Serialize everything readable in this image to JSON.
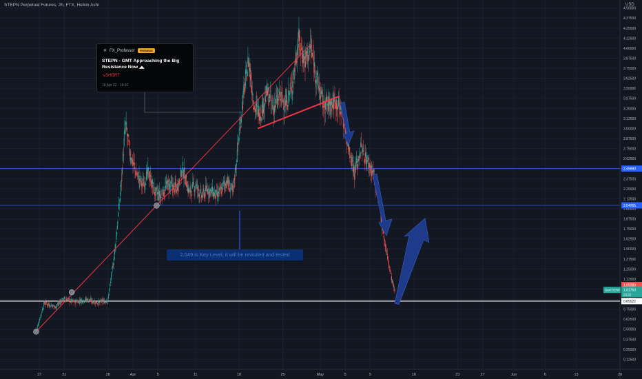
{
  "header": {
    "title": "STEPN Perpetual Futures, 2h, FTX, Heikin Ashi",
    "currency": "USD"
  },
  "idea_card": {
    "author": "FX_Professor",
    "badge": "PREMIUM",
    "headline": "STEPN - GMT Approaching the Big Resistance Now",
    "signal": "SHORT",
    "date": "18 Apr 22 · 19:32"
  },
  "note": {
    "text": "2.049 is Key Level, it will be revisited and tested"
  },
  "colors": {
    "background": "#131722",
    "candle_up": "#26a69a",
    "candle_down": "#ef5350",
    "trendline": "#f23645",
    "level_line": "#2962ff",
    "arrow": "#1e3a8a",
    "white_level": "#ffffff"
  },
  "chart_data": {
    "type": "candlestick",
    "title": "STEPN Perpetual Futures, 2h, FTX, Heikin Ashi",
    "y_axis": {
      "ticks": [
        0.125,
        0.25,
        0.375,
        0.5,
        0.625,
        0.75,
        0.875,
        1.0,
        1.125,
        1.25,
        1.375,
        1.5,
        1.625,
        1.75,
        1.875,
        2.0,
        2.125,
        2.25,
        2.375,
        2.5,
        2.625,
        2.75,
        2.875,
        3.0,
        3.125,
        3.25,
        3.375,
        3.5,
        3.625,
        3.75,
        3.875,
        4.0,
        4.125,
        4.25,
        4.375,
        4.5
      ],
      "tick_labels": [
        "0.12500",
        "0.25000",
        "0.37500",
        "0.50000",
        "0.62500",
        "0.75000",
        "0.87500",
        "1.00000",
        "1.12500",
        "1.25000",
        "1.37500",
        "1.50000",
        "1.62500",
        "1.75000",
        "1.87500",
        "2.00000",
        "2.12500",
        "2.25000",
        "2.37500",
        "2.50000",
        "2.62500",
        "2.75000",
        "2.87500",
        "3.00000",
        "3.12500",
        "3.25000",
        "3.37500",
        "3.50000",
        "3.62500",
        "3.75000",
        "3.87500",
        "4.00000",
        "4.12500",
        "4.25000",
        "4.37500",
        "4.50000"
      ],
      "range": [
        0.0,
        4.6
      ],
      "side": "right"
    },
    "x_axis": {
      "day_range": [
        15.5,
        81
      ],
      "ticks": [
        {
          "day": 17,
          "label": "17"
        },
        {
          "day": 21,
          "label": "21"
        },
        {
          "day": 28,
          "label": "28"
        },
        {
          "day": 32,
          "label": "Apr"
        },
        {
          "day": 36,
          "label": "5"
        },
        {
          "day": 42,
          "label": "11"
        },
        {
          "day": 49,
          "label": "18"
        },
        {
          "day": 56,
          "label": "25"
        },
        {
          "day": 62,
          "label": "May"
        },
        {
          "day": 66,
          "label": "5"
        },
        {
          "day": 70,
          "label": "9"
        },
        {
          "day": 77,
          "label": "16"
        },
        {
          "day": 84,
          "label": "23"
        },
        {
          "day": 88,
          "label": "27"
        },
        {
          "day": 93,
          "label": "Jun"
        },
        {
          "day": 98,
          "label": "6"
        },
        {
          "day": 103,
          "label": "13"
        },
        {
          "day": 110,
          "label": "20"
        }
      ]
    },
    "price_path": [
      [
        16.5,
        0.47
      ],
      [
        17.8,
        0.83
      ],
      [
        19.5,
        0.78
      ],
      [
        21,
        0.88
      ],
      [
        22.5,
        0.84
      ],
      [
        24.5,
        0.87
      ],
      [
        26.5,
        0.83
      ],
      [
        28,
        0.86
      ],
      [
        29,
        1.4
      ],
      [
        30,
        2.2
      ],
      [
        30.8,
        3.05
      ],
      [
        31.5,
        2.7
      ],
      [
        32.5,
        2.45
      ],
      [
        33.5,
        2.3
      ],
      [
        34.5,
        2.45
      ],
      [
        35.5,
        2.2
      ],
      [
        36.5,
        2.15
      ],
      [
        37.5,
        2.3
      ],
      [
        39,
        2.25
      ],
      [
        40,
        2.5
      ],
      [
        41,
        2.2
      ],
      [
        42,
        2.3
      ],
      [
        43,
        2.15
      ],
      [
        44,
        2.25
      ],
      [
        45.5,
        2.15
      ],
      [
        47,
        2.35
      ],
      [
        48,
        2.2
      ],
      [
        48.5,
        2.55
      ],
      [
        49.5,
        3.3
      ],
      [
        50.5,
        3.85
      ],
      [
        51.5,
        3.25
      ],
      [
        52.5,
        3.2
      ],
      [
        53.5,
        3.45
      ],
      [
        54.5,
        3.25
      ],
      [
        55.5,
        3.4
      ],
      [
        56.5,
        3.3
      ],
      [
        57.5,
        3.55
      ],
      [
        58.5,
        4.1
      ],
      [
        59.5,
        3.85
      ],
      [
        60.5,
        4.0
      ],
      [
        61.5,
        3.6
      ],
      [
        62.5,
        3.3
      ],
      [
        63.5,
        3.3
      ],
      [
        64.5,
        3.35
      ],
      [
        65.5,
        3.2
      ],
      [
        66.5,
        2.8
      ],
      [
        67.5,
        2.45
      ],
      [
        68.5,
        2.75
      ],
      [
        69.5,
        2.6
      ],
      [
        70.5,
        2.45
      ],
      [
        71.5,
        2.05
      ],
      [
        72,
        1.75
      ],
      [
        72.5,
        1.5
      ],
      [
        73,
        1.3
      ],
      [
        73.5,
        1.1
      ],
      [
        74,
        0.95
      ]
    ],
    "levels": [
      {
        "price": 2.4999,
        "label": "2.49990",
        "color": "#2962ff"
      },
      {
        "price": 2.04265,
        "label": 2.04265,
        "color": "#2962ff"
      },
      {
        "price": 0.85022,
        "label": "0.85022",
        "color": "#ffffff"
      }
    ],
    "price_tags": [
      {
        "price": 1.0508,
        "label": "1.05080",
        "bg": "#ef5350"
      },
      {
        "price": 0.985,
        "label": "1.01760",
        "sub": "23:32",
        "name": "GMTPERP",
        "bg": "#26a69a"
      }
    ],
    "trendlines": [
      {
        "from": [
          16.5,
          0.47
        ],
        "to": [
          60.5,
          4.05
        ],
        "width": 1,
        "markers": true
      },
      {
        "from": [
          52,
          3.0
        ],
        "to": [
          65,
          3.4
        ],
        "width": 2,
        "markers": false
      }
    ]
  }
}
